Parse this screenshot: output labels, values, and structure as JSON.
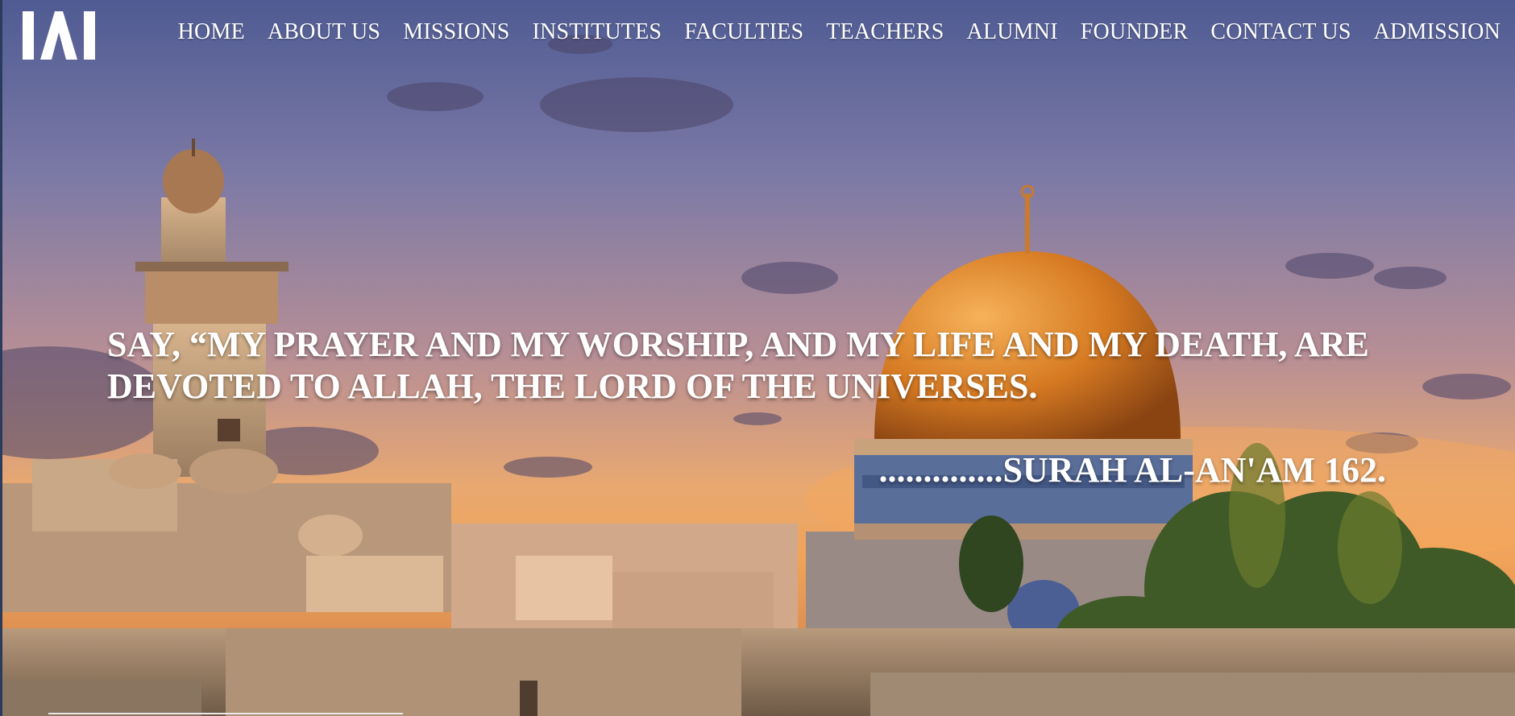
{
  "brand": {
    "logo_text": "IAI",
    "icon": "iai-logo-icon"
  },
  "nav": {
    "items": [
      {
        "label": "HOME"
      },
      {
        "label": "ABOUT US"
      },
      {
        "label": "MISSIONS"
      },
      {
        "label": "INSTITUTES"
      },
      {
        "label": "FACULTIES"
      },
      {
        "label": "TEACHERS"
      },
      {
        "label": "ALUMNI"
      },
      {
        "label": "FOUNDER"
      },
      {
        "label": "CONTACT US"
      },
      {
        "label": "ADMISSION"
      }
    ]
  },
  "hero": {
    "quote": "SAY, “MY PRAYER AND MY WORSHIP, AND MY LIFE AND MY DEATH, ARE DEVOTED TO ALLAH, THE LORD OF THE UNIVERSES.",
    "citation": "..............SURAH AL-AN'AM 162.",
    "image": "jerusalem-dome-of-the-rock-sunset-photo"
  },
  "colors": {
    "sky_top": "#5f6a9e",
    "sky_mid": "#b68a8c",
    "sky_horizon": "#f2a05a",
    "dome_gold": "#d8832c",
    "stone": "#c9a47e",
    "text": "#ffffff"
  }
}
